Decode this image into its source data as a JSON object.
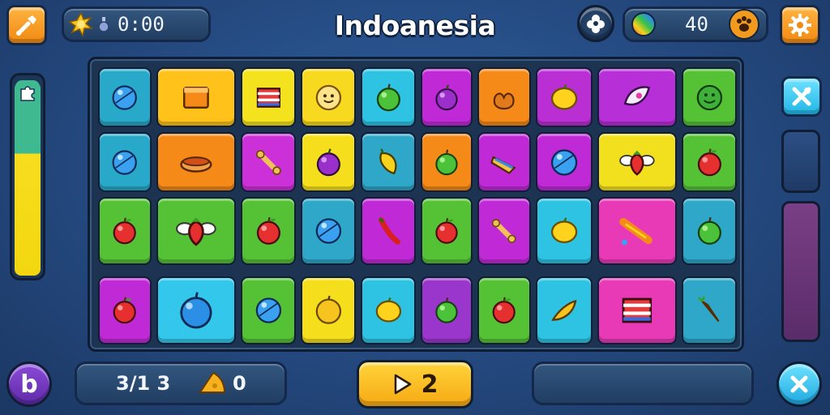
{
  "header": {
    "title": "Indoanesia",
    "timer_value": "0:00",
    "score_value": "40"
  },
  "footer": {
    "moves_value": "3/1 3",
    "collect_value": "0",
    "play_label": "2",
    "b_badge_label": "b"
  },
  "meter": {
    "fill_fraction": 0.98
  },
  "colors": {
    "accent_orange": "#f39a1e",
    "accent_cyan": "#2bbde9",
    "board_bg": "#1c3452"
  },
  "board": {
    "tiles": [
      {
        "color": "#28a9c9",
        "icon": "blue-ball"
      },
      {
        "color": "#ffc21a",
        "icon": "orange-box"
      },
      {
        "color": "#f4e21f",
        "icon": "striped-candy"
      },
      {
        "color": "#f7d91f",
        "icon": "smiley-candy"
      },
      {
        "color": "#2fc3e3",
        "icon": "green-apple"
      },
      {
        "color": "#c02ad6",
        "icon": "purple-plum"
      },
      {
        "color": "#f58a18",
        "icon": "pretzel"
      },
      {
        "color": "#b92fd4",
        "icon": "lemon"
      },
      {
        "color": "#b72fd6",
        "icon": "rocket"
      },
      {
        "color": "#55c236",
        "icon": "green-smiley"
      },
      {
        "color": "#28a9c9",
        "icon": "blue-ball"
      },
      {
        "color": "#f58a18",
        "icon": "hot-dog"
      },
      {
        "color": "#cc30d8",
        "icon": "bone"
      },
      {
        "color": "#f5df1d",
        "icon": "purple-plum"
      },
      {
        "color": "#2fa7c8",
        "icon": "yellow-pepper"
      },
      {
        "color": "#f58a18",
        "icon": "green-apple"
      },
      {
        "color": "#c02ad6",
        "icon": "sandwich"
      },
      {
        "color": "#c02ad6",
        "icon": "blue-ball"
      },
      {
        "color": "#f2e01f",
        "icon": "winged-strawberry"
      },
      {
        "color": "#55c236",
        "icon": "red-apple"
      },
      {
        "color": "#55c236",
        "icon": "red-apple"
      },
      {
        "color": "#55c236",
        "icon": "winged-strawberry"
      },
      {
        "color": "#55c236",
        "icon": "red-apple"
      },
      {
        "color": "#2fa7c8",
        "icon": "blue-ball"
      },
      {
        "color": "#c02ad6",
        "icon": "red-chili"
      },
      {
        "color": "#55c236",
        "icon": "red-apple"
      },
      {
        "color": "#c02ad6",
        "icon": "bone"
      },
      {
        "color": "#2fc3e3",
        "icon": "lemon"
      },
      {
        "color": "#e83ab7",
        "icon": "carrot-stick"
      },
      {
        "color": "#2fa7c8",
        "icon": "green-apple"
      },
      {
        "color": "#c02ad6",
        "icon": "red-apple"
      },
      {
        "color": "#34c7ec",
        "icon": "blue-apple"
      },
      {
        "color": "#55c236",
        "icon": "blue-ball"
      },
      {
        "color": "#f5df1d",
        "icon": "orange-fruit"
      },
      {
        "color": "#2fc3e3",
        "icon": "lemon"
      },
      {
        "color": "#9a36cc",
        "icon": "green-apple"
      },
      {
        "color": "#55c236",
        "icon": "red-apple"
      },
      {
        "color": "#2fc3e3",
        "icon": "banana"
      },
      {
        "color": "#e83ab7",
        "icon": "striped-candy"
      },
      {
        "color": "#2fa7c8",
        "icon": "carrot"
      }
    ]
  }
}
